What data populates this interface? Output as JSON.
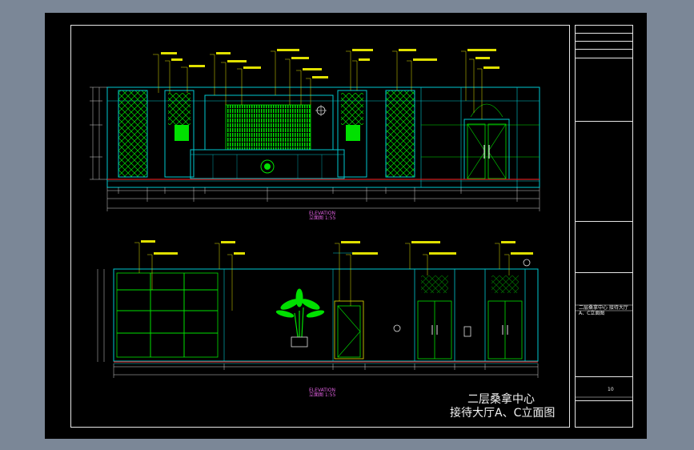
{
  "sheet": {
    "title_line1": "二层桑拿中心",
    "title_line2": "接待大厅A、C立面图"
  },
  "elevations": {
    "a": {
      "label": "ELEVATION",
      "sublabel": "立面图 1:55"
    },
    "c": {
      "label": "ELEVATION",
      "sublabel": "立面图 1:55"
    }
  },
  "titleblock": {
    "drawing_name": "二层桑拿中心 接待大厅A、C立面图",
    "sheet_no": "10"
  },
  "colors": {
    "background": "#7b8797",
    "sheet": "#000000",
    "frame": "#e6e6e6",
    "wall_lines": "#00c8d0",
    "green_panels": "#00e000",
    "annotation": "#e0e000",
    "dimension": "#d0d0d0",
    "floor_line": "#d02020",
    "label_mark": "#e060e0"
  }
}
